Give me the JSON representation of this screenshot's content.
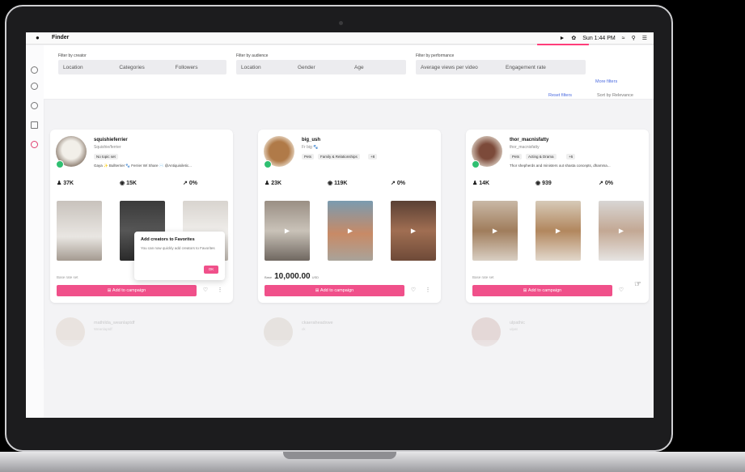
{
  "menubar": {
    "app_name": "Finder",
    "clock": "Sun 1:44 PM"
  },
  "filters": {
    "groups": [
      {
        "label": "Filter by creator",
        "fields": [
          "Location",
          "Categories",
          "Followers"
        ]
      },
      {
        "label": "Filter by audience",
        "fields": [
          "Location",
          "Gender",
          "Age"
        ]
      },
      {
        "label": "Filter by performance",
        "fields": [
          "Average views per video",
          "Engagement rate"
        ]
      }
    ],
    "more_filters": "More filters",
    "reset_filters": "Reset filters",
    "sort_by": "Sort by Relevance"
  },
  "creators": [
    {
      "handle": "squishieferrier",
      "subtitle": "Squishie/ferrier",
      "tags": [
        "No topic set"
      ],
      "bio": "Gaya ✨ Bullterrier 🐾 Ferrier W/ Share ✉️ @Antiquisiletic...",
      "stats": {
        "followers": "37K",
        "views": "15K",
        "engagement": "0%"
      },
      "rate_label": "Base rate set",
      "add_label": "Add to campaign"
    },
    {
      "handle": "big_ush",
      "subtitle": "Fr big 🐾",
      "tags": [
        "Pets",
        "Family & Relationships",
        "+8"
      ],
      "rate_label": "Base",
      "rate": "10,000.00",
      "rate_unit": "USD",
      "stats": {
        "followers": "23K",
        "views": "119K",
        "engagement": "0%"
      },
      "add_label": "Add to campaign"
    },
    {
      "handle": "thor_macnisfatty",
      "subtitle": "thor_macnisfatty",
      "tags": [
        "Pets",
        "Acting & Drama",
        "+6"
      ],
      "bio": "Thor shepherds and ministers out shasta concepts, dhamma...",
      "stats": {
        "followers": "14K",
        "views": "939",
        "engagement": "0%"
      },
      "rate_label": "Base rate set",
      "add_label": "Add to campaign"
    }
  ],
  "popover": {
    "title": "Add creators to Favorites",
    "body": "You can now quickly add creators to Favorites",
    "ok": "OK"
  },
  "faded_creators": [
    {
      "name": "mathilda_weanlaptdf",
      "sub": "Weanlaptdf"
    },
    {
      "name": "ckaeraheadxwe",
      "sub": "ck"
    },
    {
      "name": "ulpathic",
      "sub": "ulpat"
    }
  ]
}
